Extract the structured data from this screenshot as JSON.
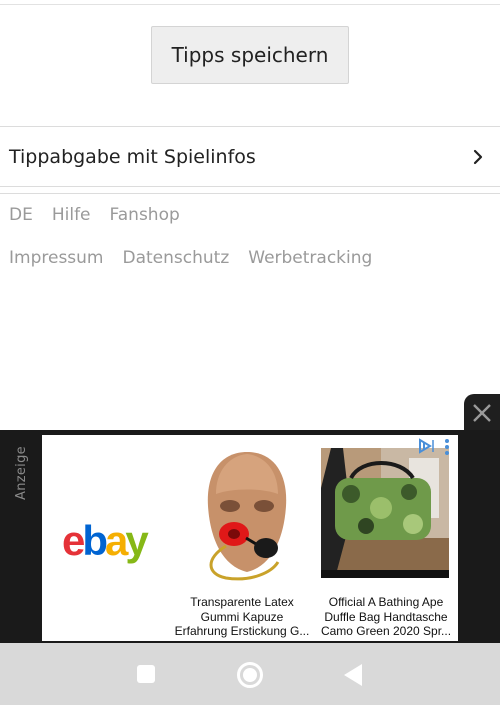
{
  "form": {
    "save_label": "Tipps speichern"
  },
  "menu": {
    "tipp_row_label": "Tippabgabe mit Spielinfos"
  },
  "footer": {
    "links_row1": [
      "DE",
      "Hilfe",
      "Fanshop"
    ],
    "links_row2": [
      "Impressum",
      "Datenschutz",
      "Werbetracking"
    ]
  },
  "ad": {
    "label": "Anzeige",
    "brand": {
      "e": "e",
      "b": "b",
      "a": "a",
      "y": "y"
    },
    "brand_colors": {
      "e": "#e53238",
      "b": "#0064d2",
      "a": "#f5af02",
      "y": "#86b817"
    },
    "products": [
      {
        "title_lines": [
          "Transparente Latex",
          "Gummi Kapuze",
          "Erfahrung Erstickung G..."
        ]
      },
      {
        "title_lines": [
          "Official A Bathing Ape",
          "Duffle Bag Handtasche",
          "Camo Green 2020 Spr..."
        ]
      }
    ],
    "accent_color": "#4a8fd8"
  },
  "icons": {
    "chevron": "chevron-right-icon",
    "close": "close-icon",
    "adchoices": "adchoices-icon",
    "more": "more-vertical-icon",
    "nav": [
      "recent-apps-icon",
      "home-icon",
      "back-icon"
    ]
  }
}
